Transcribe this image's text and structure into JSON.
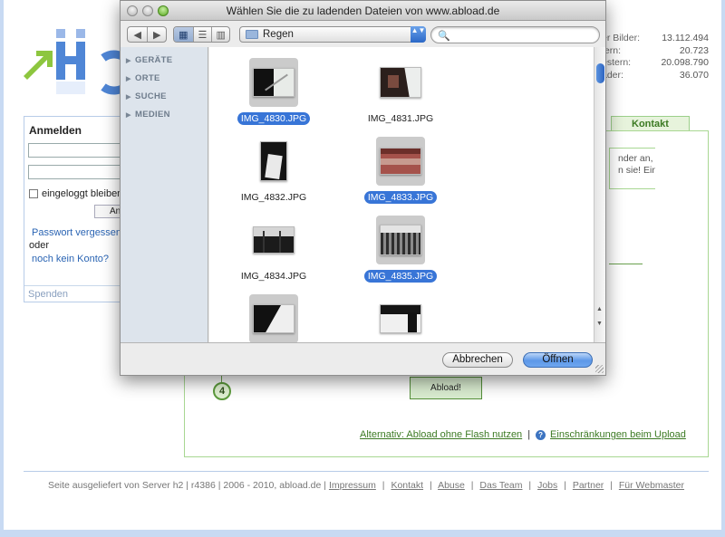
{
  "background_page": {
    "stats": [
      {
        "label": "er Bilder:",
        "value": "13.112.494"
      },
      {
        "label": "tern:",
        "value": "20.723"
      },
      {
        "label": "estern:",
        "value": "20.098.790"
      },
      {
        "label": "ader:",
        "value": "36.070"
      }
    ],
    "login": {
      "title": "Anmelden",
      "remember_label": "eingeloggt bleiben",
      "submit_label": "Anmelden",
      "forgot_password": "Passwort vergessen?",
      "or_text": "oder",
      "no_account": "noch kein Konto?",
      "donate": "Spenden"
    },
    "contact_tab": "Kontakt",
    "side_text_lines": [
      "nder an,",
      "n sie! Ein"
    ],
    "step_number": "4",
    "upload_button": "Abload!",
    "alt_links": {
      "no_flash": "Alternativ: Abload ohne Flash nutzen",
      "separator": "|",
      "help_icon": "?",
      "restrictions": "Einschränkungen beim Upload"
    },
    "footer": {
      "text": "Seite ausgeliefert von Server h2 | r4386 | 2006 - 2010, abload.de |",
      "links": [
        "Impressum",
        "Kontakt",
        "Abuse",
        "Das Team",
        "Jobs",
        "Partner",
        "Für Webmaster"
      ],
      "separator": "|"
    }
  },
  "dialog": {
    "title": "Wählen Sie die zu ladenden Dateien von www.abload.de",
    "nav": {
      "back": "◀",
      "forward": "▶"
    },
    "view_modes": {
      "icon": "▦",
      "list": "☰",
      "column": "▥",
      "active": "icon"
    },
    "folder": "Regen",
    "folder_arrows": "▲▼",
    "search_icon": "🔍",
    "search_value": "",
    "sidebar_sections": [
      "GERÄTE",
      "ORTE",
      "SUCHE",
      "MEDIEN"
    ],
    "sidebar_triangle": "▶",
    "files": [
      {
        "name": "IMG_4830.JPG",
        "selected": true
      },
      {
        "name": "IMG_4831.JPG",
        "selected": false
      },
      {
        "name": "IMG_4832.JPG",
        "selected": false
      },
      {
        "name": "IMG_4833.JPG",
        "selected": true
      },
      {
        "name": "IMG_4834.JPG",
        "selected": false
      },
      {
        "name": "IMG_4835.JPG",
        "selected": true
      },
      {
        "name": "",
        "selected": true
      },
      {
        "name": "",
        "selected": false
      }
    ],
    "scroll_up": "▲",
    "scroll_down": "▼",
    "cancel_label": "Abbrechen",
    "open_label": "Öffnen"
  },
  "colors": {
    "selection": "#3875d7",
    "page_border": "#c8daf3",
    "green_accent": "#a8d792",
    "link_blue": "#2a64b3"
  }
}
